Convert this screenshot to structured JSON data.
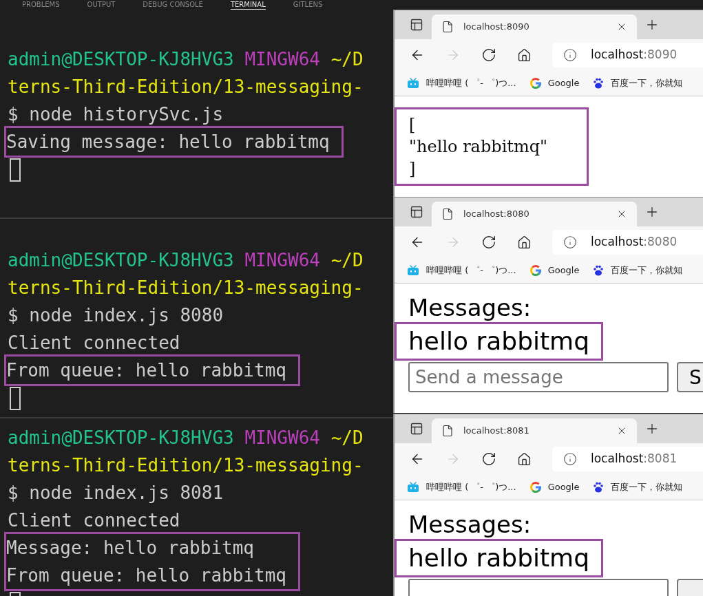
{
  "panel_tabs": [
    {
      "label": "PROBLEMS",
      "selected": false
    },
    {
      "label": "OUTPUT",
      "selected": false
    },
    {
      "label": "DEBUG CONSOLE",
      "selected": false
    },
    {
      "label": "TERMINAL",
      "selected": true
    },
    {
      "label": "GITLENS",
      "selected": false
    }
  ],
  "terminals": [
    {
      "cursor": true,
      "lines": [
        {
          "kind": "prompt",
          "user": "admin@DESKTOP-KJ8HVG3",
          "shell": "MINGW64",
          "path": "~/D",
          "highlighted": false
        },
        {
          "kind": "path",
          "text": "terns-Third-Edition/13-messaging-",
          "highlighted": false
        },
        {
          "kind": "command",
          "text": "$ node historySvc.js",
          "highlighted": false
        },
        {
          "kind": "output",
          "text": "Saving message: hello rabbitmq",
          "highlighted": true
        }
      ]
    },
    {
      "cursor": true,
      "lines": [
        {
          "kind": "prompt",
          "user": "admin@DESKTOP-KJ8HVG3",
          "shell": "MINGW64",
          "path": "~/D",
          "highlighted": false
        },
        {
          "kind": "path",
          "text": "terns-Third-Edition/13-messaging-",
          "highlighted": false
        },
        {
          "kind": "command",
          "text": "$ node index.js 8080",
          "highlighted": false
        },
        {
          "kind": "output",
          "text": "Client connected",
          "highlighted": false
        },
        {
          "kind": "output",
          "text": "From queue: hello rabbitmq",
          "highlighted": true
        }
      ]
    },
    {
      "cursor": true,
      "lines": [
        {
          "kind": "prompt",
          "user": "admin@DESKTOP-KJ8HVG3",
          "shell": "MINGW64",
          "path": "~/D",
          "highlighted": false
        },
        {
          "kind": "path",
          "text": "terns-Third-Edition/13-messaging-",
          "highlighted": false
        },
        {
          "kind": "command",
          "text": "$ node index.js 8081",
          "highlighted": false
        },
        {
          "kind": "output",
          "text": "Client connected",
          "highlighted": false
        },
        {
          "kind": "output",
          "text": "Message: hello rabbitmq",
          "highlighted": true
        },
        {
          "kind": "output",
          "text": "From queue: hello rabbitmq",
          "highlighted": true
        }
      ]
    }
  ],
  "browsers": [
    {
      "tab_title": "localhost:8090",
      "url_host": "localhost",
      "url_port": ":8090",
      "bookmarks": [
        {
          "kind": "tv",
          "label": "哔哩哔哩 ( ゜- ゜)つ..."
        },
        {
          "kind": "g",
          "label": "Google"
        },
        {
          "kind": "paw",
          "label": "百度一下，你就知"
        }
      ],
      "page": {
        "kind": "json",
        "highlighted": true,
        "lines": [
          "[",
          "\"hello rabbitmq\"",
          "]"
        ]
      }
    },
    {
      "tab_title": "localhost:8080",
      "url_host": "localhost",
      "url_port": ":8080",
      "bookmarks": [
        {
          "kind": "tv",
          "label": "哔哩哔哩 ( ゜- ゜)つ..."
        },
        {
          "kind": "g",
          "label": "Google"
        },
        {
          "kind": "paw",
          "label": "百度一下，你就知"
        }
      ],
      "page": {
        "kind": "chat",
        "heading": "Messages:",
        "messages": [
          {
            "text": "hello rabbitmq",
            "highlighted": true
          }
        ],
        "placeholder": "Send a message",
        "send_label": "S"
      }
    },
    {
      "tab_title": "localhost:8081",
      "url_host": "localhost",
      "url_port": ":8081",
      "bookmarks": [
        {
          "kind": "tv",
          "label": "哔哩哔哩 ( ゜- ゜)つ..."
        },
        {
          "kind": "g",
          "label": "Google"
        },
        {
          "kind": "paw",
          "label": "百度一下，你就知"
        }
      ],
      "page": {
        "kind": "chat",
        "heading": "Messages:",
        "messages": [
          {
            "text": "hello rabbitmq",
            "highlighted": true
          }
        ]
      }
    }
  ]
}
